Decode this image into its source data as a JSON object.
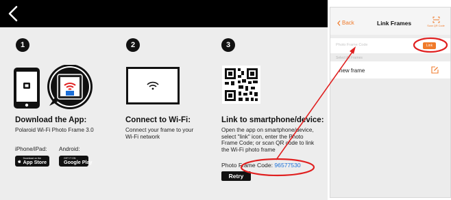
{
  "instruction_screen": {
    "steps": [
      {
        "number": "1",
        "title": "Download the App:",
        "text": "Polaroid Wi-Fi Photo Frame 3.0",
        "iphone_label": "iPhone/iPad:",
        "android_label": "Android:",
        "app_store": {
          "small": "Download on the",
          "big": "App Store"
        },
        "google_play": {
          "small": "GET IT ON",
          "big": "Google Play"
        }
      },
      {
        "number": "2",
        "title": "Connect to Wi-Fi:",
        "text_lines": [
          "Connect your frame to your",
          "Wi-Fi network"
        ]
      },
      {
        "number": "3",
        "title": "Link to smartphone/device:",
        "text_lines": [
          "Open the app on smartphone/device,",
          "select \"link\" icon, enter the Photo",
          "Frame Code; or scan QR code to link",
          "the Wi-Fi photo frame"
        ],
        "code_label": "Photo Frame Code:",
        "code_value": "96577530",
        "retry_label": "Retry"
      }
    ]
  },
  "link_frames_screen": {
    "back_label": "Back",
    "title": "Link Frames",
    "scan_label": "Scan QR Code",
    "code_placeholder": "Photo Frame Code",
    "link_label": "Link",
    "section_label": "Select All Frames",
    "frame_name": "new frame"
  },
  "colors": {
    "accent": "#f07a2a",
    "annotation": "#e02020",
    "code_link": "#1b6fd8"
  }
}
